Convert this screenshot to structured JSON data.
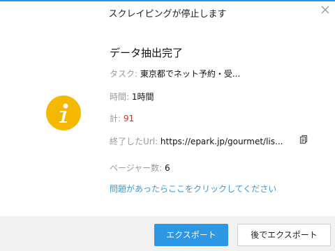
{
  "dialog": {
    "title": "スクレイピングが停止します",
    "icons": {
      "close": "close-icon",
      "status": "info-icon",
      "copy": "copy-icon"
    },
    "accent_color": "#2d97e3",
    "status_color": "#f5b800"
  },
  "summary": {
    "heading": "データ抽出完了",
    "task_label": "タスク: ",
    "task_value": "東京都でネット予約・受...",
    "time_label": "時間: ",
    "time_value": "1時間",
    "total_label": "計: ",
    "total_value": "91",
    "url_label": "終了したUrl: ",
    "url_value": "https://epark.jp/gourmet/lis...",
    "pages_label": "ページャー数: ",
    "pages_value": "6"
  },
  "help_link": "問題があったらここをクリックしてください",
  "buttons": {
    "export": "エクスポート",
    "export_later": "後でエクスポート"
  }
}
